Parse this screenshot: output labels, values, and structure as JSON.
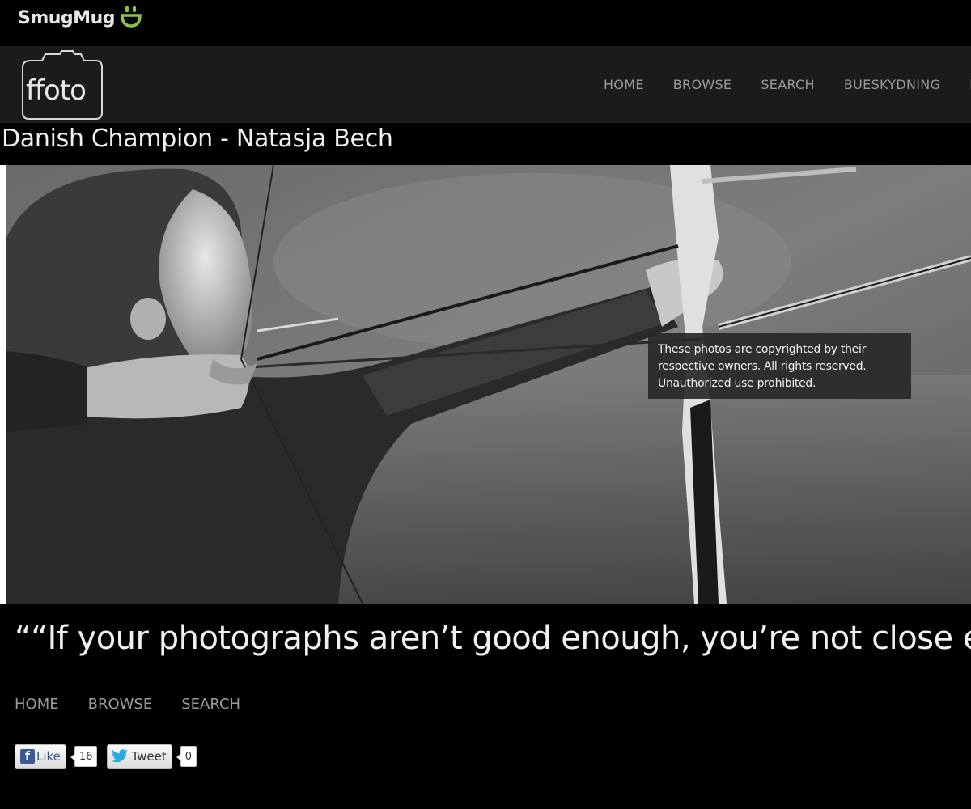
{
  "topbar": {
    "brand": "SmugMug"
  },
  "header": {
    "logo_text": "ffoto",
    "nav": [
      "HOME",
      "BROWSE",
      "SEARCH",
      "BUESKYDNING",
      "N"
    ]
  },
  "page": {
    "title": "Danish Champion - Natasja Bech"
  },
  "photo": {
    "copyright_lines": [
      "These photos are copyrighted by their",
      "respective owners. All rights reserved.",
      "Unauthorized use prohibited."
    ]
  },
  "quote": "““If your photographs aren’t good enough, you’re not close e",
  "footer": {
    "nav": [
      "HOME",
      "BROWSE",
      "SEARCH"
    ]
  },
  "social": {
    "like_label": "Like",
    "like_count": "16",
    "tweet_label": "Tweet",
    "tweet_count": "0"
  },
  "colors": {
    "brand_green": "#8cc63f",
    "nav_gray": "#9a9a9a",
    "header_bg": "#1b1b1b"
  }
}
